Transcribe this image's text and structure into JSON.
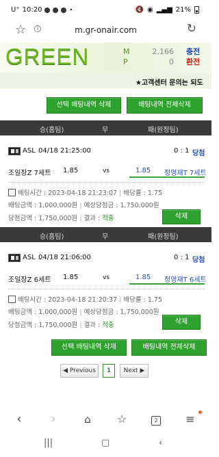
{
  "status_bar": {
    "time": "10:20",
    "carrier": "U⁺",
    "battery": "21%"
  },
  "browser": {
    "url": "m.gr-onair.com"
  },
  "header": {
    "logo": "GREEN",
    "m_label": "M",
    "p_label": "P",
    "m_value": "2,166",
    "p_value": "0",
    "charge": "충전",
    "exchange": "환전"
  },
  "ticker": {
    "text": "★고객센터 문의는 되도"
  },
  "actions": {
    "delete_selected": "선택 배팅내역 삭제",
    "delete_all": "배팅내역 전체삭제"
  },
  "table_header": {
    "home": "승(홈팀)",
    "draw": "무",
    "away": "패(원정팀)"
  },
  "bets": [
    {
      "league": "ASL",
      "match_time": "04/18 21:25:00",
      "score": "0 : 1",
      "result": "당첨",
      "home_team": "조일장Z 7세트",
      "home_odds": "1.85",
      "vs": "vs",
      "away_odds": "1.85",
      "away_team": "정영재T 7세트",
      "bet_time_label": "배팅시간 : 2023-04-18 21:23:07",
      "bet_rate_label": "배당률 : 1.75",
      "bet_amount_label": "배팅금액 : 1,000,000원",
      "expected_label": "예상당첨금 : 1,750,000원",
      "win_amount_label": "당첨금액 : 1,750,000원",
      "outcome_label": "결과 :",
      "outcome_value": "적중",
      "delete": "삭제"
    },
    {
      "league": "ASL",
      "match_time": "04/18 21:06:00",
      "score": "0 : 1",
      "result": "당첨",
      "home_team": "조일장Z 6세트",
      "home_odds": "1.85",
      "vs": "vs",
      "away_odds": "1.85",
      "away_team": "정영재T 6세트",
      "bet_time_label": "배팅시간 : 2023-04-18 21:20:37",
      "bet_rate_label": "배당률 : 1.75",
      "bet_amount_label": "배팅금액 : 1,000,000원",
      "expected_label": "예상당첨금 : 1,750,000원",
      "win_amount_label": "당첨금액 : 1,750,000원",
      "outcome_label": "결과 :",
      "outcome_value": "적중",
      "delete": "삭제"
    }
  ],
  "pagination": {
    "previous": "Previous",
    "current": "1",
    "next": "Next"
  },
  "colors": {
    "accent_green": "#2fa12f",
    "win_blue": "#2a52be",
    "charge_blue": "#2244aa",
    "exchange_red": "#cc2211"
  }
}
